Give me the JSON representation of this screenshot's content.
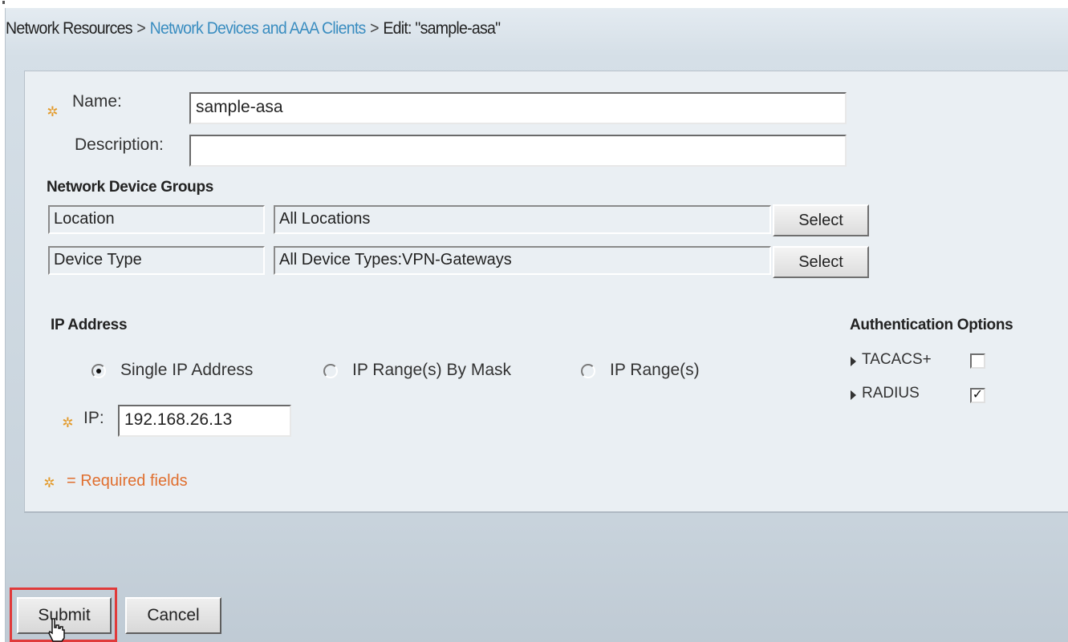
{
  "breadcrumb": {
    "root": "Network Resources",
    "separator": ">",
    "link": "Network Devices and AAA Clients",
    "current": "Edit: \"sample-asa\""
  },
  "form": {
    "name_label": "Name:",
    "name_value": "sample-asa",
    "description_label": "Description:",
    "description_value": ""
  },
  "ndg": {
    "heading": "Network Device Groups",
    "rows": [
      {
        "label": "Location",
        "value": "All Locations",
        "button": "Select"
      },
      {
        "label": "Device Type",
        "value": "All Device Types:VPN-Gateways",
        "button": "Select"
      }
    ]
  },
  "ip": {
    "heading": "IP Address",
    "options": [
      {
        "label": "Single IP Address",
        "selected": true
      },
      {
        "label": "IP Range(s) By Mask",
        "selected": false
      },
      {
        "label": "IP Range(s)",
        "selected": false
      }
    ],
    "ip_label": "IP:",
    "ip_value": "192.168.26.13"
  },
  "auth": {
    "heading": "Authentication Options",
    "options": [
      {
        "label": "TACACS+",
        "checked": false
      },
      {
        "label": "RADIUS",
        "checked": true
      }
    ]
  },
  "required_note": "= Required fields",
  "actions": {
    "submit": "Submit",
    "cancel": "Cancel"
  },
  "colors": {
    "link": "#3a8dc0",
    "required": "#e06f2f",
    "required_icon": "#e39a2a",
    "highlight": "#e03a3a"
  },
  "icons": {
    "required": "required-field-icon",
    "expand": "triangle-right-icon",
    "cursor": "hand-pointer-icon"
  }
}
